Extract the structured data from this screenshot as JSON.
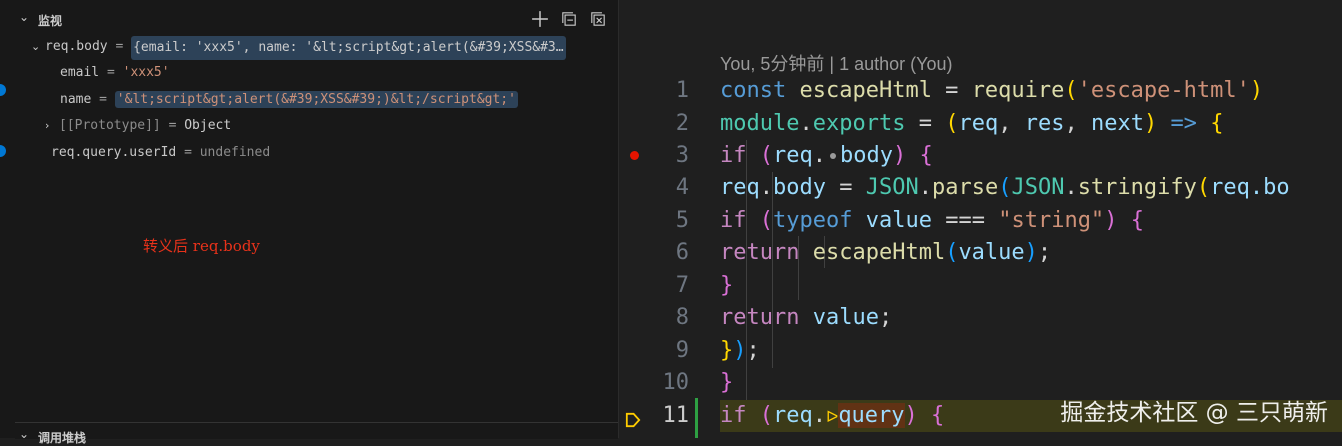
{
  "watch": {
    "section_title": "监视",
    "tools": [
      "add-expression",
      "collapse-all",
      "remove-all"
    ],
    "req_body": {
      "name": "req.body",
      "eq": "=",
      "value": "{email: 'xxx5', name: '&lt;script&gt;alert(&#39;XSS&#3…"
    },
    "email": {
      "name": "email",
      "eq": "=",
      "value": "'xxx5'"
    },
    "name_prop": {
      "name": "name",
      "eq": "=",
      "value": "'&lt;script&gt;alert(&#39;XSS&#39;)&lt;/script&gt;'"
    },
    "prototype": {
      "name": "[[Prototype]]",
      "eq": "=",
      "value": "Object"
    },
    "req_query": {
      "name": "req.query.userId",
      "eq": "=",
      "value": "undefined"
    }
  },
  "annotation": "转义后 req.body",
  "call_stack": {
    "section_title": "调用堆栈"
  },
  "editor": {
    "codelens": "You, 5分钟前 | 1 author (You)",
    "lines": [
      {
        "n": "1"
      },
      {
        "n": "2"
      },
      {
        "n": "3"
      },
      {
        "n": "4"
      },
      {
        "n": "5"
      },
      {
        "n": "6"
      },
      {
        "n": "7"
      },
      {
        "n": "8"
      },
      {
        "n": "9"
      },
      {
        "n": "10"
      },
      {
        "n": "11"
      }
    ],
    "tokens": {
      "const": "const",
      "escapeHtml": "escapeHtml",
      "eq": " = ",
      "require": "require",
      "mod_str": "'escape-html'",
      "module": "module",
      "exports": "exports",
      "req": "req",
      "res": "res",
      "next": "next",
      "arrow": "=>",
      "if": "if",
      "body": "body",
      "json": "JSON",
      "parse": "parse",
      "stringify": "stringify",
      "req_bo": "req.bo",
      "typeof": "typeof",
      "value": "value",
      "strict_eq": "===",
      "string_lit": "\"string\"",
      "return": "return",
      "query": "query"
    }
  },
  "watermark": "掘金技术社区 @ 三只萌新",
  "colors": {
    "accent": "#0078d4",
    "breakpoint": "#e51400",
    "git_added": "#2ea043",
    "note": "#e8321a"
  }
}
